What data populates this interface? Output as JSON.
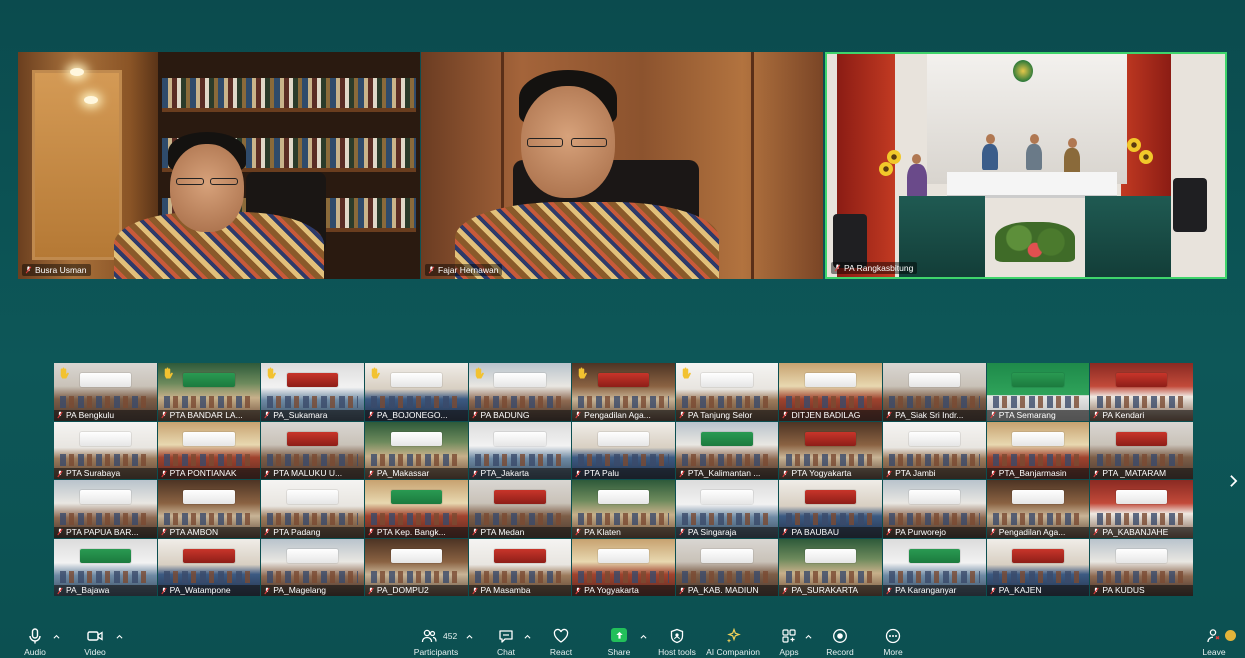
{
  "speakers": [
    {
      "name": "Busra Usman"
    },
    {
      "name": "Fajar Hernawan"
    },
    {
      "name": "PA Rangkasbitung"
    }
  ],
  "grid_tiles": [
    {
      "name": "PA Bengkulu",
      "raised_hand": true
    },
    {
      "name": "PTA BANDAR LA...",
      "raised_hand": true
    },
    {
      "name": "PA_Sukamara",
      "raised_hand": true
    },
    {
      "name": "PA_BOJONEGO...",
      "raised_hand": true
    },
    {
      "name": "PA BADUNG",
      "raised_hand": true
    },
    {
      "name": "Pengadilan Aga...",
      "raised_hand": true
    },
    {
      "name": "PA Tanjung Selor",
      "raised_hand": true
    },
    {
      "name": "DITJEN BADILAG",
      "raised_hand": false
    },
    {
      "name": "PA_Siak Sri Indr...",
      "raised_hand": false
    },
    {
      "name": "PTA Semarang",
      "raised_hand": false
    },
    {
      "name": "PA Kendari",
      "raised_hand": false
    },
    {
      "name": "PTA Surabaya",
      "raised_hand": false
    },
    {
      "name": "PTA PONTIANAK",
      "raised_hand": false
    },
    {
      "name": "PTA MALUKU U...",
      "raised_hand": false
    },
    {
      "name": "PA_Makassar",
      "raised_hand": false
    },
    {
      "name": "PTA_Jakarta",
      "raised_hand": false
    },
    {
      "name": "PTA Palu",
      "raised_hand": false
    },
    {
      "name": "PTA_Kalimantan ...",
      "raised_hand": false
    },
    {
      "name": "PTA Yogyakarta",
      "raised_hand": false
    },
    {
      "name": "PTA Jambi",
      "raised_hand": false
    },
    {
      "name": "PTA_Banjarmasin",
      "raised_hand": false
    },
    {
      "name": "PTA _MATARAM",
      "raised_hand": false
    },
    {
      "name": "PTA PAPUA BAR...",
      "raised_hand": false
    },
    {
      "name": "PTA AMBON",
      "raised_hand": false
    },
    {
      "name": "PTA Padang",
      "raised_hand": false
    },
    {
      "name": "PTA Kep. Bangk...",
      "raised_hand": false
    },
    {
      "name": "PTA Medan",
      "raised_hand": false
    },
    {
      "name": "PA Klaten",
      "raised_hand": false
    },
    {
      "name": "PA Singaraja",
      "raised_hand": false
    },
    {
      "name": "PA BAUBAU",
      "raised_hand": false
    },
    {
      "name": "PA Purworejo",
      "raised_hand": false
    },
    {
      "name": "Pengadilan Aga...",
      "raised_hand": false
    },
    {
      "name": "PA_KABANJAHE",
      "raised_hand": false
    },
    {
      "name": "PA_Bajawa",
      "raised_hand": false
    },
    {
      "name": "PA_Watampone",
      "raised_hand": false
    },
    {
      "name": "PA_Magelang",
      "raised_hand": false
    },
    {
      "name": "PA_DOMPU2",
      "raised_hand": false
    },
    {
      "name": "PA Masamba",
      "raised_hand": false
    },
    {
      "name": "PA Yogyakarta",
      "raised_hand": false
    },
    {
      "name": "PA_KAB. MADIUN",
      "raised_hand": false
    },
    {
      "name": "PA_SURAKARTA",
      "raised_hand": false
    },
    {
      "name": "PA Karanganyar",
      "raised_hand": false
    },
    {
      "name": "PA_KAJEN",
      "raised_hand": false
    },
    {
      "name": "PA KUDUS",
      "raised_hand": false
    }
  ],
  "toolbar": {
    "audio": "Audio",
    "video": "Video",
    "participants": "Participants",
    "participants_count": "452",
    "chat": "Chat",
    "react": "React",
    "share": "Share",
    "host_tools": "Host tools",
    "ai_companion": "AI Companion",
    "apps": "Apps",
    "record": "Record",
    "more": "More",
    "leave": "Leave"
  },
  "colors": {
    "background": "#0d5758",
    "active_speaker_border": "#3fd46b",
    "share_icon": "#22c05a",
    "muted_mic": "#e23b3b",
    "raised_hand": "#f2c230"
  }
}
